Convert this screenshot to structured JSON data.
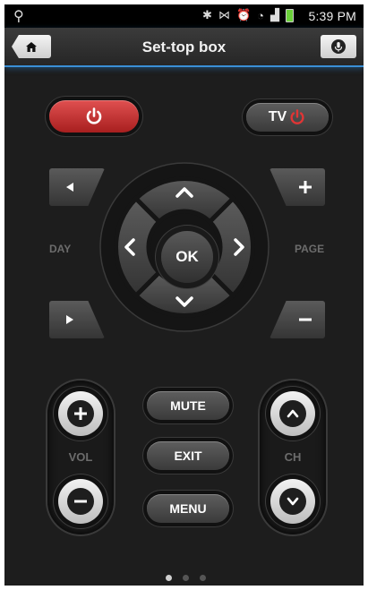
{
  "status_bar": {
    "usb_icon": "usb-icon",
    "icons": [
      "bluetooth-icon",
      "vibrate-icon",
      "alarm-icon",
      "wifi-icon",
      "signal-icon",
      "battery-icon"
    ],
    "time": "5:39 PM"
  },
  "header": {
    "title": "Set-top box",
    "home_icon": "home-icon",
    "mic_icon": "microphone-icon"
  },
  "remote": {
    "tv_label": "TV",
    "day_label": "DAY",
    "page_label": "PAGE",
    "ok_label": "OK",
    "vol_label": "VOL",
    "ch_label": "CH",
    "mute_label": "MUTE",
    "exit_label": "EXIT",
    "menu_label": "MENU"
  },
  "colors": {
    "power_red": "#c93030",
    "accent_blue": "#3a8fd6",
    "background": "#1d1d1d"
  },
  "pager": {
    "pages": 3,
    "current": 1
  }
}
